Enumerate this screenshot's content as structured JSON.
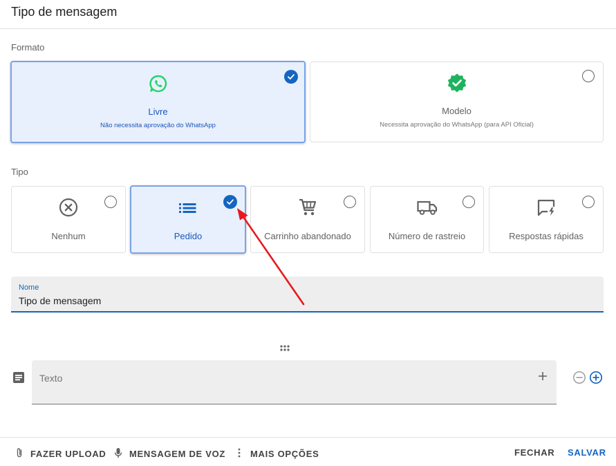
{
  "dialog": {
    "title": "Tipo de mensagem"
  },
  "formato": {
    "label": "Formato",
    "options": [
      {
        "title": "Livre",
        "subtitle": "Não necessita aprovação do WhatsApp",
        "selected": true,
        "icon": "whatsapp-icon"
      },
      {
        "title": "Modelo",
        "subtitle": "Necessita aprovação do WhatsApp (para API Oficial)",
        "selected": false,
        "icon": "verified-badge-icon"
      }
    ]
  },
  "tipo": {
    "label": "Tipo",
    "options": [
      {
        "title": "Nenhum",
        "selected": false,
        "icon": "cancel-circle-icon"
      },
      {
        "title": "Pedido",
        "selected": true,
        "icon": "list-icon"
      },
      {
        "title": "Carrinho abandonado",
        "selected": false,
        "icon": "shopping-cart-icon"
      },
      {
        "title": "Número de rastreio",
        "selected": false,
        "icon": "truck-icon"
      },
      {
        "title": "Respostas rápidas",
        "selected": false,
        "icon": "quick-reply-icon"
      }
    ]
  },
  "nome_field": {
    "label": "Nome",
    "value": "Tipo de mensagem"
  },
  "texto_field": {
    "placeholder": "Texto"
  },
  "footer": {
    "upload": "FAZER UPLOAD",
    "voz": "MENSAGEM DE VOZ",
    "mais": "MAIS OPÇÕES",
    "fechar": "FECHAR",
    "salvar": "SALVAR"
  },
  "colors": {
    "accent": "#1565c0",
    "selected_bg": "#e8f0fe",
    "whatsapp": "#25d366",
    "annotation": "#e8191d"
  }
}
